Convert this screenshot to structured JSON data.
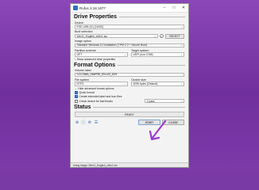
{
  "window": {
    "title": "Rufus 3.18.1877"
  },
  "drive_properties": {
    "heading": "Drive Properties",
    "device_label": "Device",
    "device_value": "ESD-USB (D:) [16GB]",
    "boot_selection_label": "Boot selection",
    "boot_selection_value": "Win11_English_x64v1.iso",
    "select_button": "SELECT",
    "image_option_label": "Image option",
    "image_option_value": "Standard Windows 11 Installation (TPM 2.0 + Secure Boot)",
    "partition_scheme_label": "Partition scheme",
    "partition_scheme_value": "GPT",
    "target_system_label": "Target system",
    "target_system_value": "UEFI (non CSM)",
    "advanced_toggle": "Show advanced drive properties"
  },
  "format_options": {
    "heading": "Format Options",
    "volume_label_label": "Volume label",
    "volume_label_value": "CCCOMA_X64FRE_EN-US_DV9",
    "file_system_label": "File system",
    "file_system_value": "NTFS",
    "cluster_size_label": "Cluster size",
    "cluster_size_value": "4096 bytes (Default)",
    "advanced_toggle": "Hide advanced format options",
    "quick_format": "Quick format",
    "extended_label": "Create extended label and icon files",
    "bad_blocks": "Check device for bad blocks",
    "passes_value": "1 pass"
  },
  "status": {
    "heading": "Status",
    "progress_text": "READY",
    "start_button": "START",
    "close_button": "CLOSE",
    "statusbar_text": "Using image: Win11_English_x64v1.iso"
  },
  "colors": {
    "background": "#7a3aa6",
    "accent": "#1e62c7",
    "arrow": "#9b3ad1"
  }
}
